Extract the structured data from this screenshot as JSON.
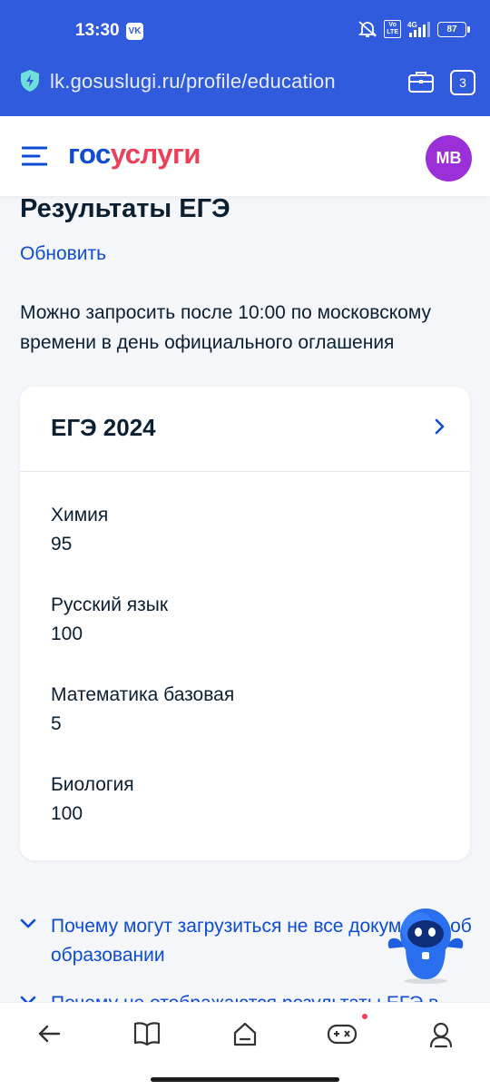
{
  "status_bar": {
    "time": "13:30",
    "vk_label": "VK",
    "volte_top": "Vo",
    "volte_bottom": "LTE",
    "network": "4G",
    "battery": "87"
  },
  "browser": {
    "url": "lk.gosuslugi.ru/profile/education",
    "tabs_count": "3"
  },
  "header": {
    "logo_part1": "гос",
    "logo_part2": "услуги",
    "avatar_initials": "МВ"
  },
  "page": {
    "title": "Результаты ЕГЭ",
    "refresh_link": "Обновить",
    "info_text": "Можно запросить после 10:00 по московскому времени в день официального оглашения"
  },
  "exam_card": {
    "title": "ЕГЭ 2024",
    "subjects": [
      {
        "name": "Химия",
        "score": "95"
      },
      {
        "name": "Русский язык",
        "score": "100"
      },
      {
        "name": "Математика базовая",
        "score": "5"
      },
      {
        "name": "Биология",
        "score": "100"
      }
    ]
  },
  "faq": [
    {
      "text": "Почему могут загрузиться не все документы об образовании"
    },
    {
      "text": "Почему не отображаются результаты ЕГЭ в"
    }
  ],
  "colors": {
    "brand_blue": "#0d4cd3",
    "brand_red": "#ee3f58",
    "topbar": "#2f5bdc",
    "avatar": "#9b30d9"
  }
}
